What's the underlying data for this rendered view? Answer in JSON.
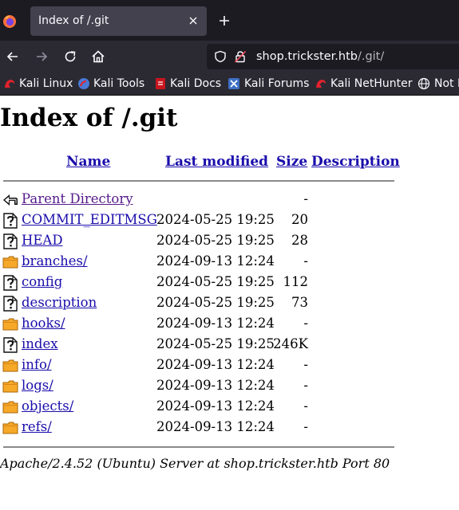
{
  "browser": {
    "tab_title": "Index of /.git",
    "url_host": "shop.trickster.htb",
    "url_path": "/.git/",
    "bookmarks": [
      {
        "label": "Kali Linux",
        "icon": "kali-dragon-icon"
      },
      {
        "label": "Kali Tools",
        "icon": "kali-tools-icon"
      },
      {
        "label": "Kali Docs",
        "icon": "kali-docs-icon"
      },
      {
        "label": "Kali Forums",
        "icon": "kali-forums-icon"
      },
      {
        "label": "Kali NetHunter",
        "icon": "kali-nethunter-icon"
      },
      {
        "label": "Not F",
        "icon": "globe-icon"
      }
    ]
  },
  "page": {
    "title": "Index of /.git",
    "columns": {
      "name": "Name",
      "modified": "Last modified",
      "size": "Size",
      "description": "Description"
    },
    "parent": {
      "name": "Parent Directory",
      "size": "-"
    },
    "entries": [
      {
        "name": "COMMIT_EDITMSG",
        "modified": "2024-05-25 19:25",
        "size": "20",
        "icon": "unknown-file-icon"
      },
      {
        "name": "HEAD",
        "modified": "2024-05-25 19:25",
        "size": "28",
        "icon": "unknown-file-icon"
      },
      {
        "name": "branches/",
        "modified": "2024-09-13 12:24",
        "size": "-",
        "icon": "folder-icon"
      },
      {
        "name": "config",
        "modified": "2024-05-25 19:25",
        "size": "112",
        "icon": "unknown-file-icon"
      },
      {
        "name": "description",
        "modified": "2024-05-25 19:25",
        "size": "73",
        "icon": "unknown-file-icon"
      },
      {
        "name": "hooks/",
        "modified": "2024-09-13 12:24",
        "size": "-",
        "icon": "folder-icon"
      },
      {
        "name": "index",
        "modified": "2024-05-25 19:25",
        "size": "246K",
        "icon": "unknown-file-icon"
      },
      {
        "name": "info/",
        "modified": "2024-09-13 12:24",
        "size": "-",
        "icon": "folder-icon"
      },
      {
        "name": "logs/",
        "modified": "2024-09-13 12:24",
        "size": "-",
        "icon": "folder-icon"
      },
      {
        "name": "objects/",
        "modified": "2024-09-13 12:24",
        "size": "-",
        "icon": "folder-icon"
      },
      {
        "name": "refs/",
        "modified": "2024-09-13 12:24",
        "size": "-",
        "icon": "folder-icon"
      }
    ],
    "footer": "Apache/2.4.52 (Ubuntu) Server at shop.trickster.htb Port 80"
  }
}
